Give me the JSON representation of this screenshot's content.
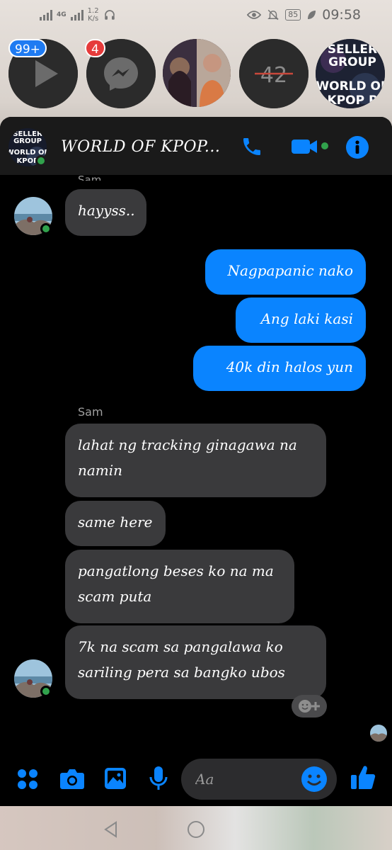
{
  "status_bar": {
    "network_1": "4G",
    "speed_value": "1.2",
    "speed_unit": "K/s",
    "battery": "85",
    "time": "09:58"
  },
  "chat_heads": [
    {
      "name": "video-app",
      "badge": "99+",
      "badge_color": "#1f7bf2"
    },
    {
      "name": "messenger",
      "badge": "4",
      "badge_color": "#e63b3b"
    },
    {
      "name": "photo-contact"
    },
    {
      "name": "contact-42",
      "text": "42"
    },
    {
      "name": "group-world-of-kpop",
      "text_top": "SELLER",
      "text_mid": "GROUP",
      "text_bottom": "WORLD OF",
      "text_last": "KPOP P"
    }
  ],
  "header": {
    "title": "WORLD OF KPOP...",
    "avatar_text_1": "SELLER",
    "avatar_text_2": "GROUP",
    "avatar_text_3": "WORLD OF",
    "avatar_text_4": "KPOP"
  },
  "messages": {
    "top_sender_cut": "Sam",
    "m1": "hayyss..",
    "out1": "Nagpapanic nako",
    "out2": "Ang laki kasi",
    "out3": "40k din halos yun",
    "sender2": "Sam",
    "in1": "lahat ng tracking ginagawa na namin",
    "in2": "same here",
    "in3": "pangatlong beses ko na ma scam puta",
    "in4": "7k na scam sa pangalawa ko sariling pera sa bangko ubos"
  },
  "composer": {
    "placeholder": "Aa"
  },
  "colors": {
    "accent": "#0a84ff",
    "incoming_bubble": "#3a3a3c",
    "online": "#31a24c",
    "panel_bg": "#000000"
  },
  "icons": [
    "phone-icon",
    "video-icon",
    "info-icon",
    "apps-icon",
    "camera-icon",
    "gallery-icon",
    "mic-icon",
    "emoji-icon",
    "thumbs-up-icon",
    "back-icon",
    "home-icon"
  ]
}
